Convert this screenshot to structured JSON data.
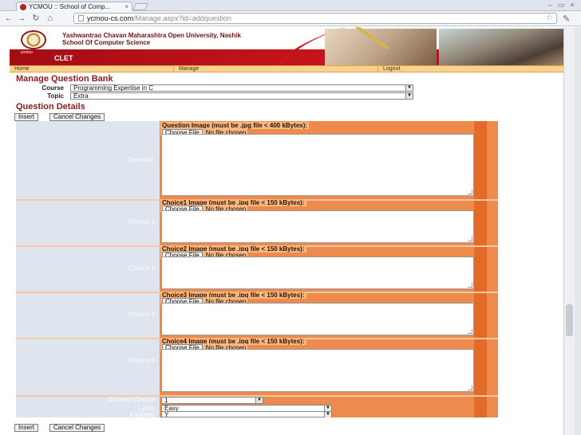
{
  "browser": {
    "tab_title": "YCMOU :: School of Comp...",
    "tab_close": "×",
    "url_host": "ycmou-cs.com",
    "url_path": "/Manage.aspx?id=addquestion"
  },
  "banner": {
    "logo_caption": "ycmou",
    "university": "Yashwantrao Chavan Maharashtra Open University, Nashik",
    "school": "School Of Computer Science",
    "clet": "CLET"
  },
  "menu": {
    "home": "Home",
    "manage": "Manage",
    "logout": "Logout"
  },
  "page": {
    "heading": "Manage Question Bank",
    "course_label": "Course",
    "course_value": "Programming Expertise in C",
    "topic_label": "Topic",
    "topic_value": "Extra",
    "details_heading": "Question Details",
    "insert_label": "Insert",
    "cancel_label": "Cancel Changes"
  },
  "form": {
    "file_button": "Choose File",
    "file_status": "No file chosen",
    "rows": [
      {
        "label": "Question",
        "image_label": "Question Image (must be .jpg file < 400 kBytes):"
      },
      {
        "label": "Choice 1",
        "image_label": "Choice1 Image (must be .jpg file < 150 kBytes):"
      },
      {
        "label": "Choice 2",
        "image_label": "Choice2 Image (must be .jpg file < 150 kBytes):"
      },
      {
        "label": "Choice 3",
        "image_label": "Choice3 Image (must be .jpg file < 150 kBytes):"
      },
      {
        "label": "Choice 4",
        "image_label": "Choice4 Image (must be .jpg file < 150 kBytes):"
      }
    ],
    "correct_label": "Correct Choice",
    "correct_value": "1",
    "level_label": "Level",
    "level_value": "Easy",
    "enabled_label": "Enabled",
    "enabled_value": "Y"
  },
  "icons": {
    "back": "←",
    "forward": "→",
    "reload": "↻",
    "home": "⌂",
    "star": "☆",
    "wrench": "✎",
    "dropdown": "▼",
    "minimize": "–",
    "maximize": "▭",
    "close": "×"
  },
  "colors": {
    "accent_red": "#c8141b",
    "form_orange": "#ee8a4c",
    "menu_tan": "#f9d28f"
  }
}
